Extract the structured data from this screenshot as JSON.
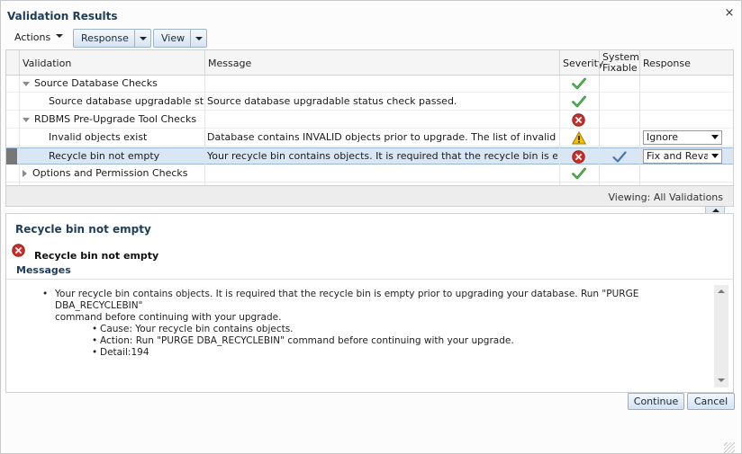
{
  "dialog": {
    "title": "Validation Results",
    "close_glyph": "×"
  },
  "toolbar": {
    "actions_label": "Actions",
    "response_label": "Response",
    "view_label": "View"
  },
  "table": {
    "headers": {
      "validation": "Validation",
      "message": "Message",
      "severity": "Severity",
      "system_fixable_line1": "System",
      "system_fixable_line2": "Fixable",
      "response": "Response"
    },
    "rows": [
      {
        "validation": "Source Database Checks",
        "message": "",
        "severity": "success",
        "fixable": false,
        "response": "",
        "level": 0,
        "expanded": true
      },
      {
        "validation": "Source database upgradable status",
        "message": "Source database upgradable status check passed.",
        "severity": "success",
        "fixable": false,
        "response": "",
        "level": 1
      },
      {
        "validation": "RDBMS Pre-Upgrade Tool Checks",
        "message": "",
        "severity": "error",
        "fixable": false,
        "response": "",
        "level": 0,
        "expanded": true
      },
      {
        "validation": "Invalid objects exist",
        "message": "Database contains INVALID objects prior to upgrade. The list of invalid SYS/S...",
        "severity": "warning",
        "fixable": false,
        "response": "Ignore",
        "level": 1
      },
      {
        "validation": "Recycle bin not empty",
        "message": "Your recycle bin contains objects. It is required that the recycle bin is empty p...",
        "severity": "error",
        "fixable": true,
        "response": "Fix and Revalidate",
        "level": 1,
        "selected": true
      },
      {
        "validation": "Options and Permission Checks",
        "message": "",
        "severity": "success",
        "fixable": false,
        "response": "",
        "level": 0,
        "expanded": false
      }
    ],
    "viewing": "Viewing: All Validations"
  },
  "details": {
    "title": "Recycle bin not empty",
    "subtitle": "Recycle bin not empty",
    "messages_label": "Messages",
    "message_main_line1": "Your recycle bin contains objects. It is required that the recycle bin is empty prior to upgrading your database. Run \"PURGE DBA_RECYCLEBIN\"",
    "message_main_line2": "command before continuing with your upgrade.",
    "cause": "Cause: Your recycle bin contains objects.",
    "action": "Action: Run \"PURGE DBA_RECYCLEBIN\" command before continuing with your upgrade.",
    "detail": "Detail:194"
  },
  "footer": {
    "continue_label": "Continue",
    "cancel_label": "Cancel"
  },
  "colors": {
    "title": "#1f3d59",
    "selected_row": "#d9e7f5",
    "success": "#2d8a2d",
    "error": "#c0392b",
    "warning": "#f2c200"
  }
}
